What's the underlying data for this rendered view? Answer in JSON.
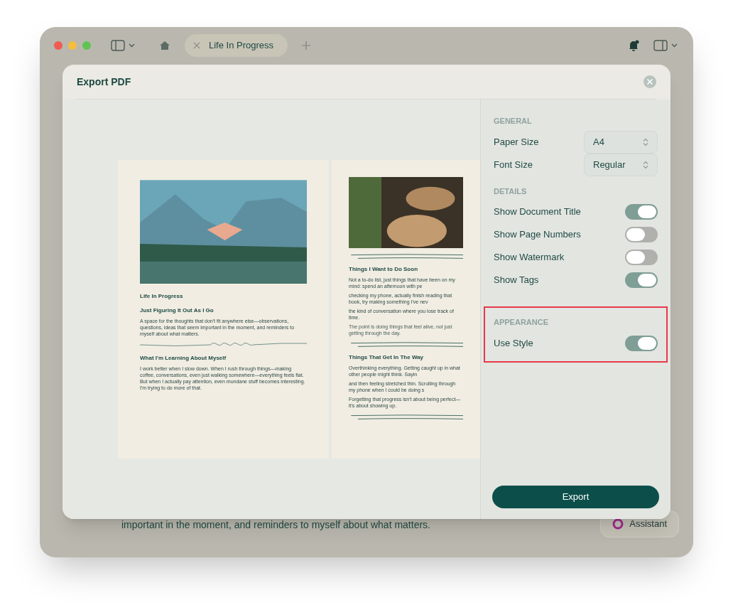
{
  "tabs": [
    {
      "label": "Life In Progress",
      "selected": true
    }
  ],
  "dialog": {
    "title": "Export PDF",
    "export_button": "Export"
  },
  "preview": {
    "pages": [
      {
        "blocks": [
          {
            "kind": "photo"
          },
          {
            "kind": "title",
            "text": "Life In Progress"
          },
          {
            "kind": "heading",
            "text": "Just Figuring It Out As I Go"
          },
          {
            "kind": "body",
            "text": "A space for the thoughts that don't fit anywhere else—observations, questions, ideas that seem important in the moment, and reminders to myself about what matters."
          },
          {
            "kind": "squiggle"
          },
          {
            "kind": "heading",
            "text": "What I'm Learning About Myself"
          },
          {
            "kind": "body",
            "text": "I work better when I slow down. When I rush through things—making coffee, conversations, even just walking somewhere—everything feels flat. But when I actually pay attention, even mundane stuff becomes interesting. I'm trying to do more of that."
          }
        ]
      },
      {
        "blocks": [
          {
            "kind": "photo"
          },
          {
            "kind": "rule"
          },
          {
            "kind": "heading",
            "text": "Things I Want to Do Soon"
          },
          {
            "kind": "body",
            "text": "Not a to-do list, just things that have been on my mind: spend an afternoon with pe"
          },
          {
            "kind": "body",
            "text": "checking my phone, actually finish reading that book, try making something I've nev"
          },
          {
            "kind": "body",
            "text": "the kind of conversation where you lose track of time."
          },
          {
            "kind": "note",
            "text": "The point is doing things that feel alive, not just getting through the day."
          },
          {
            "kind": "rule"
          },
          {
            "kind": "heading",
            "text": "Things That Get In The Way"
          },
          {
            "kind": "body",
            "text": "Overthinking everything. Getting caught up in what other people might think. Sayin"
          },
          {
            "kind": "body",
            "text": "and then feeling stretched thin. Scrolling through my phone when I could be doing s"
          },
          {
            "kind": "body",
            "text": "Forgetting that progress isn't about being perfect—it's about showing up."
          },
          {
            "kind": "rule"
          }
        ]
      }
    ]
  },
  "settings": [
    {
      "heading": "GENERAL",
      "highlighted": false,
      "rows": [
        {
          "kind": "select",
          "label": "Paper Size",
          "value": "A4"
        },
        {
          "kind": "select",
          "label": "Font Size",
          "value": "Regular"
        }
      ]
    },
    {
      "heading": "DETAILS",
      "highlighted": false,
      "rows": [
        {
          "kind": "toggle",
          "label": "Show Document Title",
          "on": true
        },
        {
          "kind": "toggle",
          "label": "Show Page Numbers",
          "on": false
        },
        {
          "kind": "toggle",
          "label": "Show Watermark",
          "on": false
        },
        {
          "kind": "toggle",
          "label": "Show Tags",
          "on": true
        }
      ]
    },
    {
      "heading": "APPEARANCE",
      "highlighted": true,
      "rows": [
        {
          "kind": "toggle",
          "label": "Use Style",
          "on": true
        }
      ]
    }
  ],
  "background_text": "important in the moment, and reminders to myself about what matters.",
  "assistant_button": "Assistant"
}
